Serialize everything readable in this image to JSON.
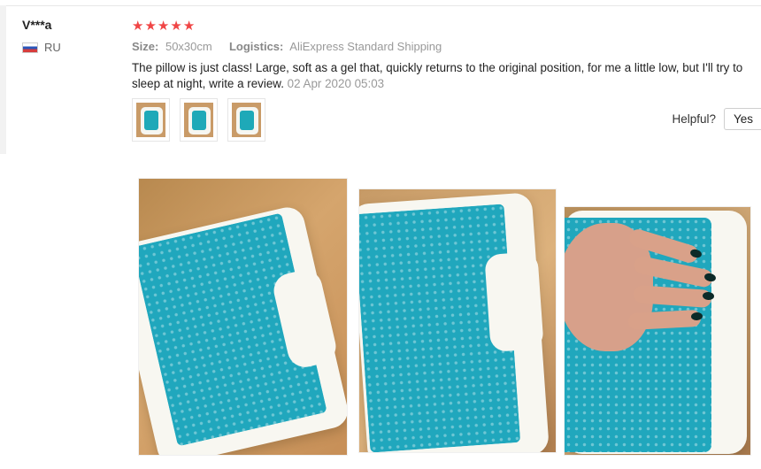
{
  "review": {
    "author": "V***a",
    "country": "RU",
    "rating_value": 5,
    "rating_max": 5,
    "size_label": "Size:",
    "size_value": "50x30cm",
    "logistics_label": "Logistics:",
    "logistics_value": "AliExpress Standard Shipping",
    "text": "The pillow is just class! Large, soft as a gel that, quickly returns to the original position, for me a little low, but I'll try to sleep at night, write a review.",
    "date": "02 Apr 2020 05:03",
    "helpful_label": "Helpful?",
    "yes_label": "Yes"
  },
  "icons": {
    "star": "star-icon",
    "flag": "russia-flag-icon"
  },
  "colors": {
    "star": "#f04545",
    "gel": "#20a7bd"
  }
}
